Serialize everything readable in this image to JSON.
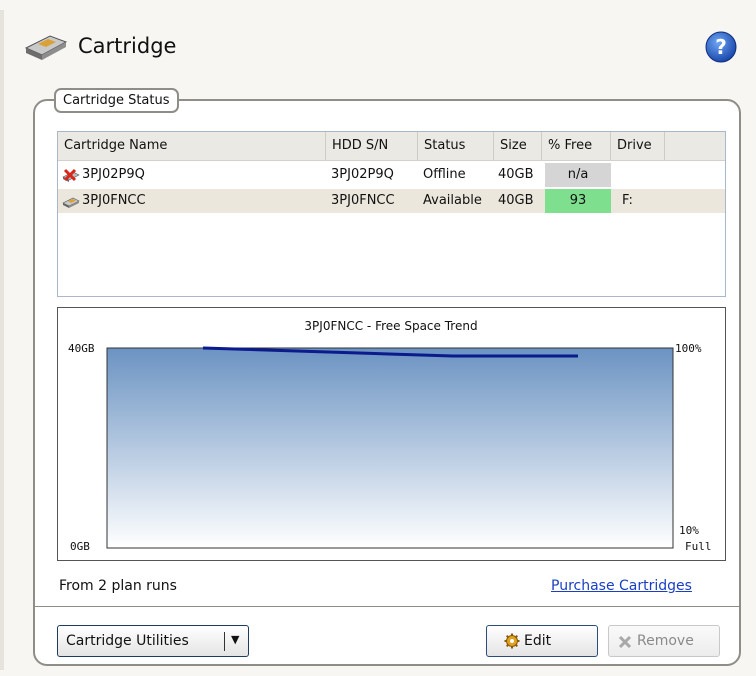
{
  "header": {
    "title": "Cartridge",
    "icon": "cartridge-icon",
    "help_icon": "help-icon"
  },
  "status_group": {
    "label": "Cartridge Status"
  },
  "table": {
    "columns": [
      "Cartridge Name",
      "HDD S/N",
      "Status",
      "Size",
      "% Free",
      "Drive"
    ],
    "rows": [
      {
        "name": "3PJ02P9Q",
        "serial": "3PJ02P9Q",
        "status": "Offline",
        "size": "40GB",
        "free": "n/a",
        "drive": "",
        "icon": "cartridge-offline-icon",
        "selected": false
      },
      {
        "name": "3PJ0FNCC",
        "serial": "3PJ0FNCC",
        "status": "Available",
        "size": "40GB",
        "free": "93",
        "drive": "F:",
        "icon": "cartridge-icon",
        "selected": true
      }
    ]
  },
  "chart_data": {
    "type": "line",
    "title": "3PJ0FNCC - Free Space Trend",
    "left_axis": {
      "top_label": "40GB",
      "bottom_label": "0GB"
    },
    "right_axis": {
      "top_label": "100%",
      "bottom_label_1": "10%",
      "bottom_label_2": "Full"
    },
    "ylim_percent": [
      0,
      100
    ],
    "series": [
      {
        "values_percent": [
          100,
          98,
          96,
          96
        ]
      }
    ],
    "line_color": "#0b1a8c"
  },
  "footer": {
    "plan_runs": "From 2 plan runs",
    "purchase_link": "Purchase Cartridges"
  },
  "buttons": {
    "utilities": "Cartridge Utilities",
    "edit": "Edit",
    "remove": "Remove"
  }
}
